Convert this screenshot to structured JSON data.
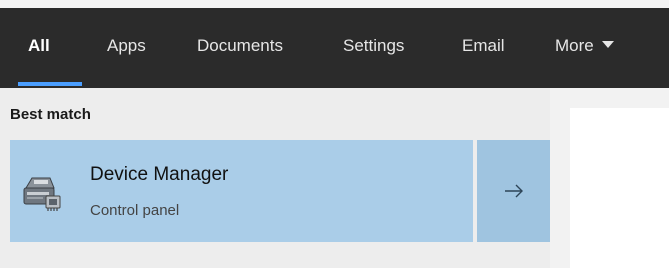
{
  "tabs": [
    {
      "label": "All",
      "active": true
    },
    {
      "label": "Apps"
    },
    {
      "label": "Documents"
    },
    {
      "label": "Settings"
    },
    {
      "label": "Email"
    },
    {
      "label": "More"
    }
  ],
  "best_match": {
    "section_label": "Best match",
    "title": "Device Manager",
    "subtitle": "Control panel",
    "icon": "device-manager-icon",
    "action_icon": "arrow-right-icon"
  },
  "colors": {
    "tab_bar_bg": "#2b2b2b",
    "accent": "#4a9eff",
    "selected_bg": "#aacde8",
    "action_bg": "#9fc4e0"
  }
}
